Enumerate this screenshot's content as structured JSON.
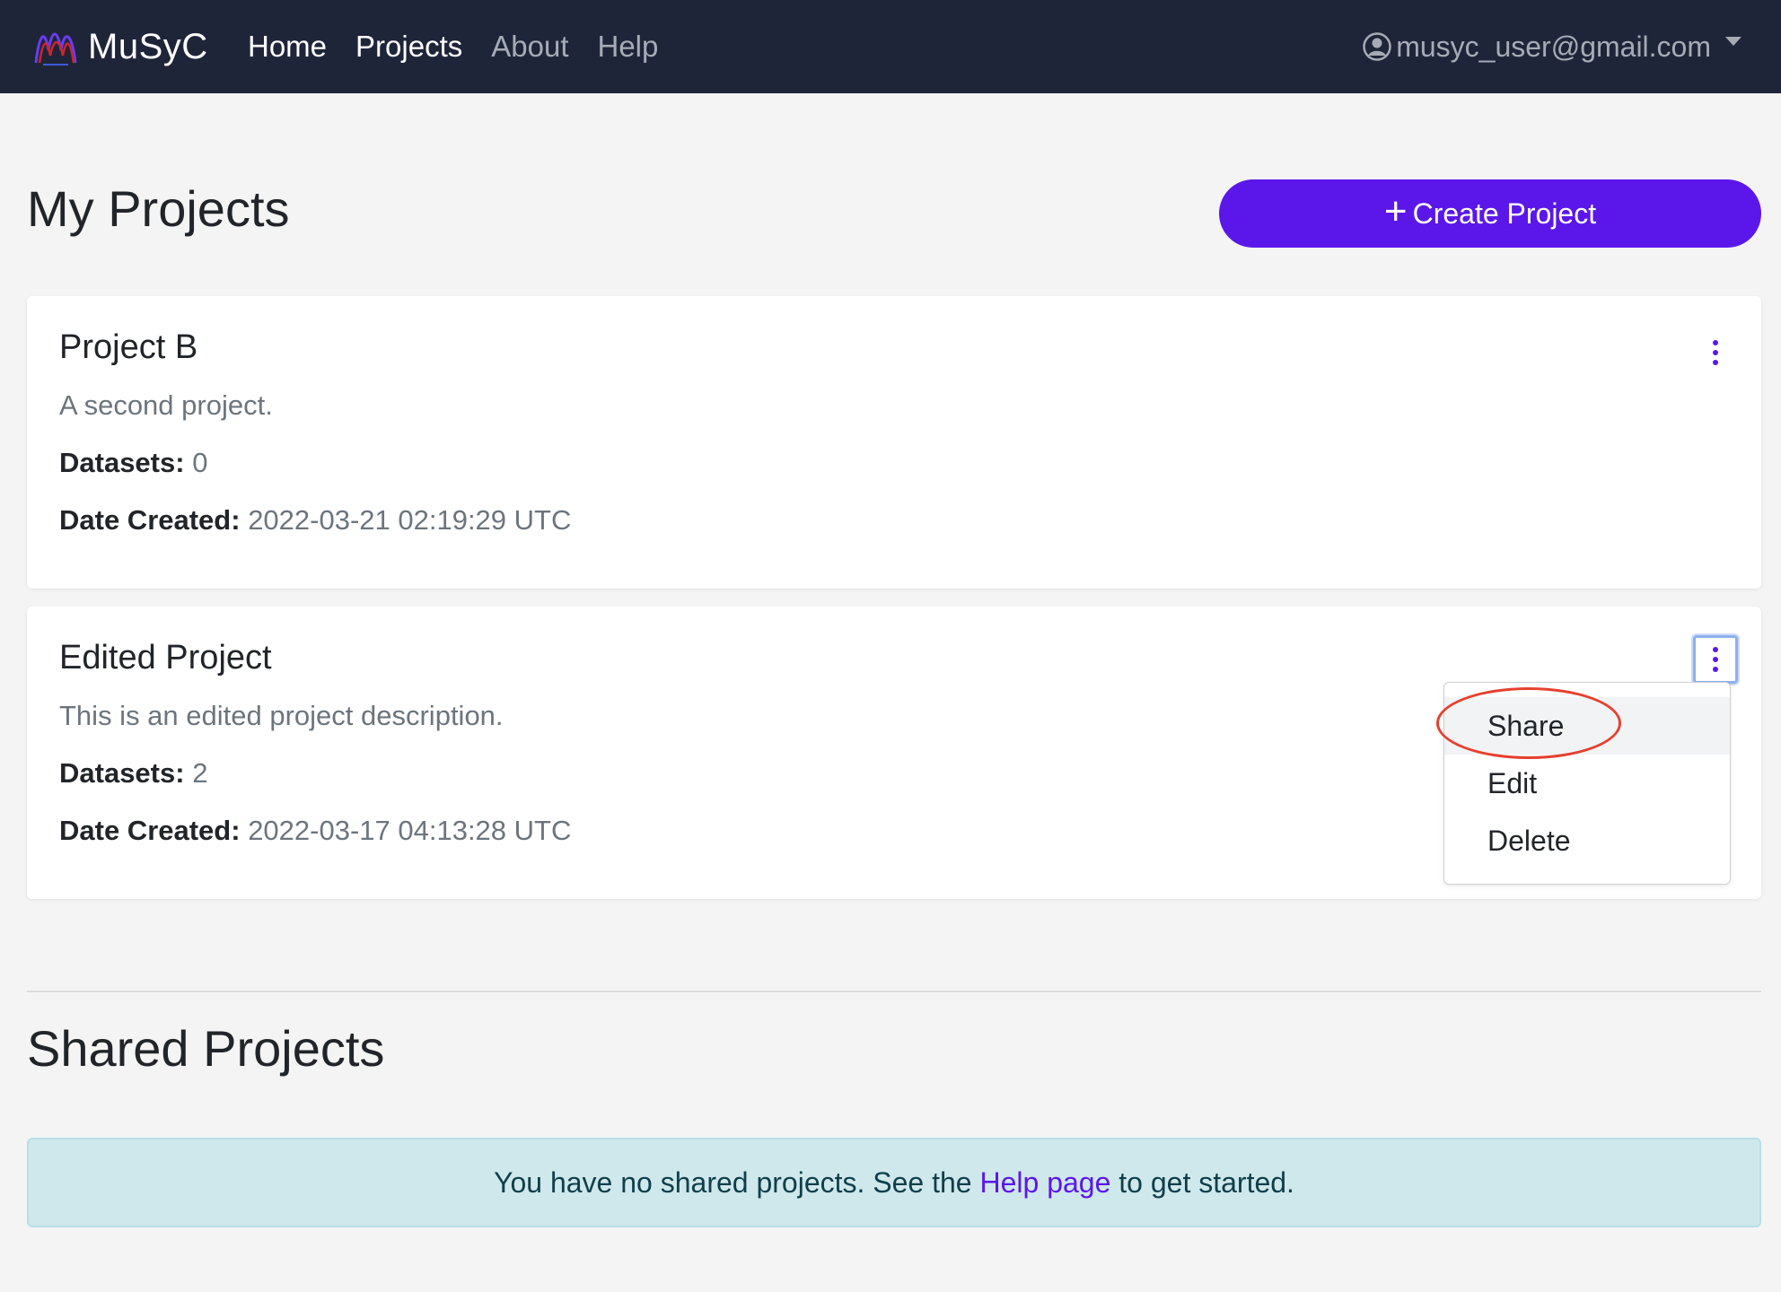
{
  "nav": {
    "brand": "MuSyC",
    "links": [
      {
        "label": "Home",
        "active": true
      },
      {
        "label": "Projects",
        "active": true
      },
      {
        "label": "About",
        "active": false
      },
      {
        "label": "Help",
        "active": false
      }
    ],
    "user_email": "musyc_user@gmail.com"
  },
  "my_projects": {
    "title": "My Projects",
    "create_label": "Create Project"
  },
  "projects": [
    {
      "name": "Project B",
      "description": "A second project.",
      "datasets_label": "Datasets:",
      "datasets": "0",
      "date_label": "Date Created:",
      "date": "2022-03-21 02:19:29 UTC"
    },
    {
      "name": "Edited Project",
      "description": "This is an edited project description.",
      "datasets_label": "Datasets:",
      "datasets": "2",
      "date_label": "Date Created:",
      "date": "2022-03-17 04:13:28 UTC"
    }
  ],
  "dropdown": {
    "items": [
      "Share",
      "Edit",
      "Delete"
    ]
  },
  "shared": {
    "title": "Shared Projects",
    "alert_before": "You have no shared projects. See the ",
    "alert_link": "Help page",
    "alert_after": " to get started."
  },
  "colors": {
    "navbar": "#1f2539",
    "accent": "#5b17ea",
    "alert_bg": "#cfe8ec",
    "annotation": "#e5402e"
  },
  "icons": {
    "logo": "musyc-logo-icon",
    "user": "user-circle-icon",
    "caret": "caret-down-icon",
    "plus": "plus-icon",
    "kebab": "kebab-menu-icon"
  }
}
